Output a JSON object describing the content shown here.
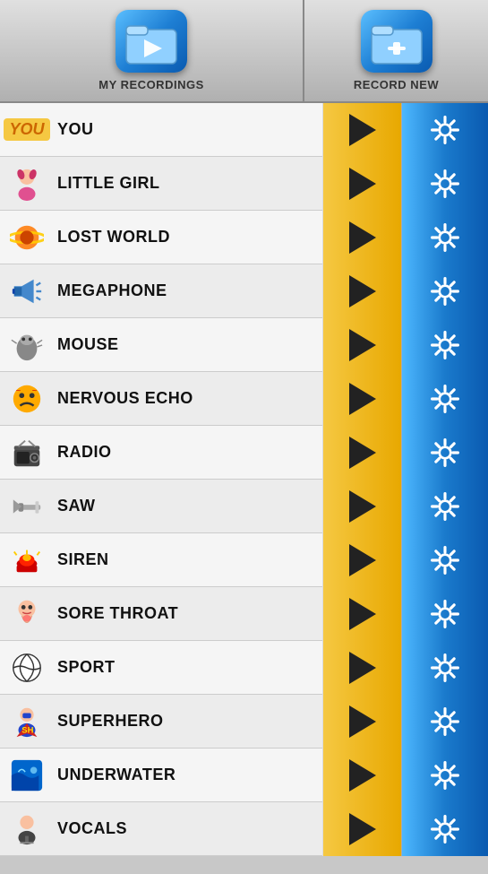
{
  "header": {
    "my_recordings_label": "MY RECORDINGS",
    "record_new_label": "RECORD NEW"
  },
  "items": [
    {
      "id": "you",
      "label": "YOU",
      "special": "YOU",
      "icon_type": "you"
    },
    {
      "id": "little-girl",
      "label": "LITTLE GIRL",
      "icon_type": "little-girl"
    },
    {
      "id": "lost-world",
      "label": "LOST WORLD",
      "icon_type": "lost-world"
    },
    {
      "id": "megaphone",
      "label": "MEGAPHONE",
      "icon_type": "megaphone"
    },
    {
      "id": "mouse",
      "label": "MOUSE",
      "icon_type": "mouse"
    },
    {
      "id": "nervous-echo",
      "label": "NERVOUS ECHO",
      "icon_type": "nervous-echo"
    },
    {
      "id": "radio",
      "label": "RADIO",
      "icon_type": "radio"
    },
    {
      "id": "saw",
      "label": "SAW",
      "icon_type": "saw"
    },
    {
      "id": "siren",
      "label": "SIREN",
      "icon_type": "siren"
    },
    {
      "id": "sore-throat",
      "label": "SORE THROAT",
      "icon_type": "sore-throat"
    },
    {
      "id": "sport",
      "label": "SPORT",
      "icon_type": "sport"
    },
    {
      "id": "superhero",
      "label": "SUPERHERO",
      "icon_type": "superhero"
    },
    {
      "id": "underwater",
      "label": "UNDERWATER",
      "icon_type": "underwater"
    },
    {
      "id": "vocals",
      "label": "VOCALS",
      "icon_type": "vocals"
    }
  ],
  "icons": {
    "you": "YOU",
    "little-girl": "👧",
    "lost-world": "🪐",
    "megaphone": "📢",
    "mouse": "🐭",
    "nervous-echo": "😰",
    "radio": "📻",
    "saw": "🔧",
    "siren": "🚨",
    "sore-throat": "🤒",
    "sport": "⚽",
    "superhero": "🦸",
    "underwater": "🌊",
    "vocals": "🎤"
  }
}
